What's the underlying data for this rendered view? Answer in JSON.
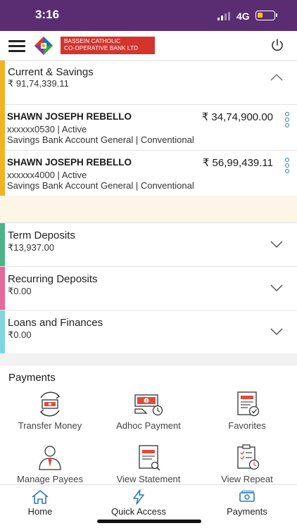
{
  "status_bar": {
    "time": "3:16",
    "network": "4G"
  },
  "header": {
    "bank_name_line1": "BASSEIN CATHOLIC",
    "bank_name_line2": "CO-OPERATIVE BANK LTD"
  },
  "current_savings": {
    "title": "Current & Savings",
    "total": "₹ 91,74,339.11",
    "accounts": [
      {
        "name": "SHAWN JOSEPH REBELLO",
        "balance": "₹ 34,74,900.00",
        "number_status": "xxxxxx0530 | Active",
        "type": "Savings Bank Account General | Conventional"
      },
      {
        "name": "SHAWN JOSEPH REBELLO",
        "balance": "₹ 56,99,439.11",
        "number_status": "xxxxxx4000 | Active",
        "type": "Savings Bank Account General | Conventional"
      }
    ]
  },
  "term_deposits": {
    "title": "Term Deposits",
    "total": "₹13,937.00"
  },
  "recurring_deposits": {
    "title": "Recurring Deposits",
    "total": "₹0.00"
  },
  "loans": {
    "title": "Loans and Finances",
    "total": "₹0.00"
  },
  "payments": {
    "title": "Payments",
    "tiles": [
      {
        "label": "Transfer Money"
      },
      {
        "label": "Adhoc Payment"
      },
      {
        "label": "Favorites"
      },
      {
        "label": "Manage Payees"
      },
      {
        "label": "View Statement"
      },
      {
        "label": "View Repeat"
      }
    ]
  },
  "bottom_nav": [
    {
      "label": "Home"
    },
    {
      "label": "Quick Access"
    },
    {
      "label": "Payments"
    }
  ],
  "colors": {
    "status_bar": "#5a2d73",
    "current_savings_accent": "#f0b323",
    "term_deposits_accent": "#4db38a",
    "recurring_deposits_accent": "#e46a9a",
    "loans_accent": "#7fd6e0",
    "brand_red": "#d5342d",
    "icon_blue": "#2a7ab8"
  }
}
